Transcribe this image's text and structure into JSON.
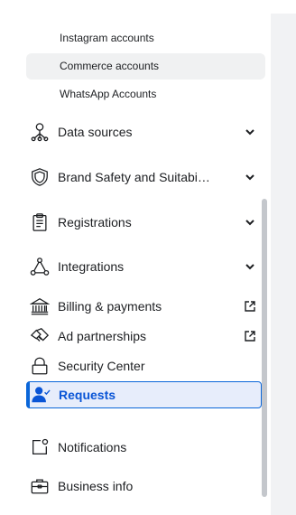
{
  "sidebar": {
    "sub_items": [
      {
        "label": "Instagram accounts",
        "selected": false
      },
      {
        "label": "Commerce accounts",
        "selected": true
      },
      {
        "label": "WhatsApp Accounts",
        "selected": false
      }
    ],
    "nav_items": [
      {
        "label": "Data sources",
        "icon": "data-sources-icon",
        "trail": "chevron-down-icon"
      },
      {
        "label": "Brand Safety and Suitabi…",
        "icon": "shield-icon",
        "trail": "chevron-down-icon"
      },
      {
        "label": "Registrations",
        "icon": "clipboard-icon",
        "trail": "chevron-down-icon"
      },
      {
        "label": "Integrations",
        "icon": "integrations-icon",
        "trail": "chevron-down-icon"
      },
      {
        "label": "Billing & payments",
        "icon": "bank-icon",
        "trail": "external-link-icon"
      },
      {
        "label": "Ad partnerships",
        "icon": "handshake-icon",
        "trail": "external-link-icon"
      },
      {
        "label": "Security Center",
        "icon": "lock-icon",
        "trail": ""
      },
      {
        "label": "Requests",
        "icon": "person-check-icon",
        "trail": "",
        "active": true
      },
      {
        "label": "Notifications",
        "icon": "notification-icon",
        "trail": ""
      },
      {
        "label": "Business info",
        "icon": "briefcase-icon",
        "trail": ""
      }
    ]
  },
  "colors": {
    "accent": "#0a66d9",
    "active_bg": "#e7edfb",
    "selected_bg": "#f0f1f2",
    "main_bg": "#f1f2f4"
  }
}
